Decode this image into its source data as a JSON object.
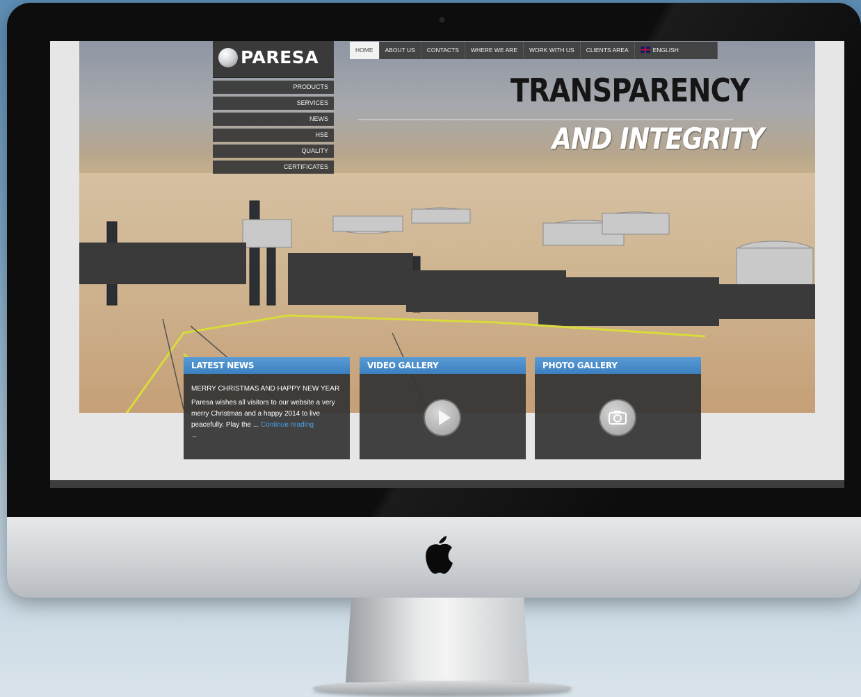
{
  "brand": {
    "name": "PARESA"
  },
  "top_nav": {
    "tabs": [
      {
        "label": "HOME",
        "active": true
      },
      {
        "label": "ABOUT US",
        "active": false
      },
      {
        "label": "CONTACTS",
        "active": false
      },
      {
        "label": "WHERE WE ARE",
        "active": false
      },
      {
        "label": "WORK WITH US",
        "active": false
      },
      {
        "label": "CLIENTS AREA",
        "active": false
      }
    ],
    "language": {
      "label": "ENGLISH",
      "icon": "uk-flag-icon"
    }
  },
  "side_nav": {
    "items": [
      "PRODUCTS",
      "SERVICES",
      "NEWS",
      "HSE",
      "QUALITY",
      "CERTIFICATES"
    ]
  },
  "hero": {
    "headline": "TRANSPARENCY",
    "subheadline": "AND INTEGRITY"
  },
  "panels": {
    "latest_news": {
      "title": "LATEST NEWS",
      "news_title": "MERRY CHRISTMAS AND HAPPY NEW YEAR",
      "news_body": "Paresa wishes all visitors to our website a very merry Christmas and a happy 2014 to live peacefully. Play the ...",
      "read_more": "Continue reading",
      "ellipsis": "→"
    },
    "video_gallery": {
      "title": "VIDEO GALLERY",
      "icon": "play-icon"
    },
    "photo_gallery": {
      "title": "PHOTO GALLERY",
      "icon": "camera-icon"
    }
  },
  "colors": {
    "accent_blue": "#3c80c0",
    "nav_dark": "#3a3a3a",
    "link_blue": "#4aa0e6"
  }
}
